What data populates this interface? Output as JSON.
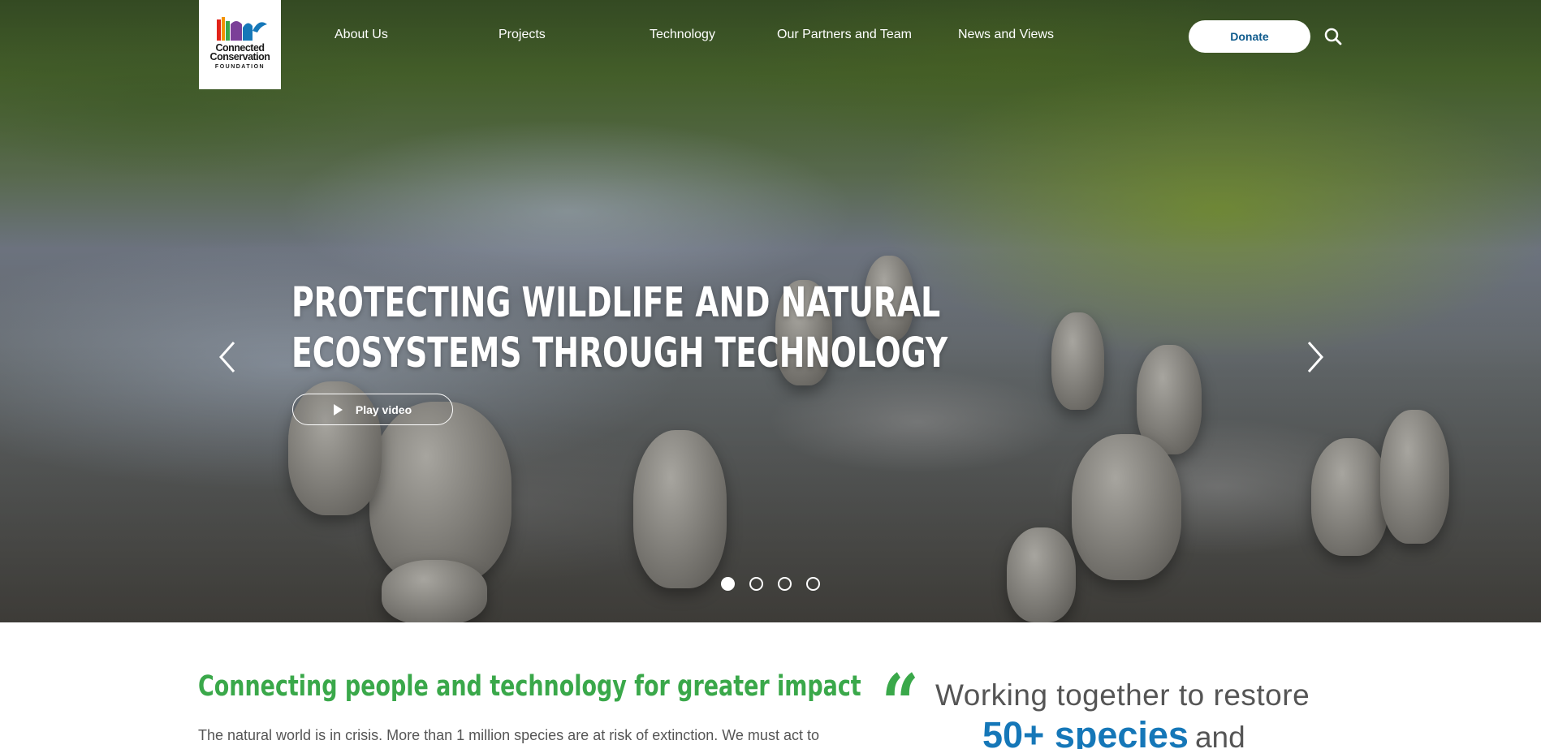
{
  "logo": {
    "line1": "Connected",
    "line2": "Conservation",
    "line3": "FOUNDATION"
  },
  "nav": {
    "items": [
      {
        "label": "About Us"
      },
      {
        "label": "Projects"
      },
      {
        "label": "Technology"
      },
      {
        "label": "Our Partners and Team"
      },
      {
        "label": "News and Views"
      }
    ],
    "donate_label": "Donate",
    "search_icon": "search-icon"
  },
  "hero": {
    "headline_line1": "PROTECTING WILDLIFE AND NATURAL",
    "headline_line2": "ECOSYSTEMS THROUGH TECHNOLOGY",
    "play_label": "Play video",
    "slides_total": 4,
    "active_slide": 1,
    "prev_icon": "chevron-left-icon",
    "next_icon": "chevron-right-icon"
  },
  "intro": {
    "title": "Connecting people and technology for greater impact",
    "text": "The natural world is in crisis. More than 1 million species are at risk of extinction. We must act to"
  },
  "quote": {
    "line1": "Working together to restore",
    "highlight": "50+ species",
    "after": "and"
  },
  "colors": {
    "accent_green": "#3aa84a",
    "accent_blue": "#1577b8",
    "donate_text": "#0d5a8c"
  }
}
